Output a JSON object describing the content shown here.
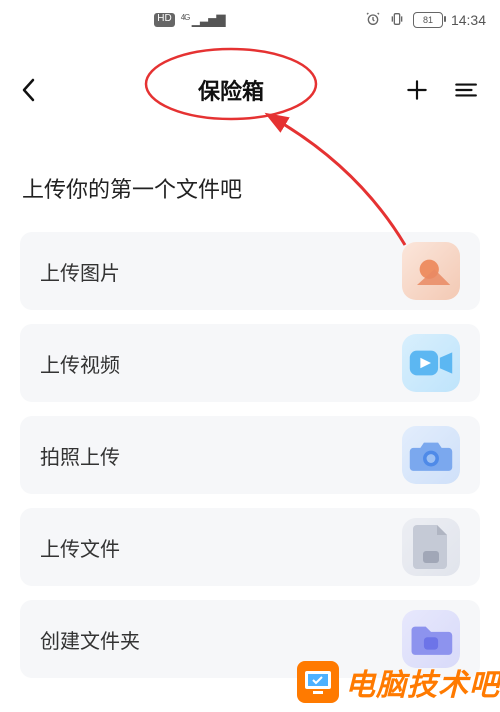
{
  "status": {
    "hd": "HD",
    "network": "4G",
    "battery": "81",
    "time": "14:34"
  },
  "header": {
    "title": "保险箱"
  },
  "prompt": "上传你的第一个文件吧",
  "actions": [
    {
      "label": "上传图片",
      "icon": "image",
      "bg": "#f7dacc",
      "fg": "#e98a63"
    },
    {
      "label": "上传视频",
      "icon": "video",
      "bg": "#cfe8fb",
      "fg": "#3fa6f4"
    },
    {
      "label": "拍照上传",
      "icon": "camera",
      "bg": "#d2e4fb",
      "fg": "#5a93ec"
    },
    {
      "label": "上传文件",
      "icon": "file",
      "bg": "#e6e8ee",
      "fg": "#b0b5c2"
    },
    {
      "label": "创建文件夹",
      "icon": "folder",
      "bg": "#dfe1fb",
      "fg": "#6d74e8"
    }
  ],
  "watermark": "电脑技术吧",
  "annotation_color": "#e53232"
}
